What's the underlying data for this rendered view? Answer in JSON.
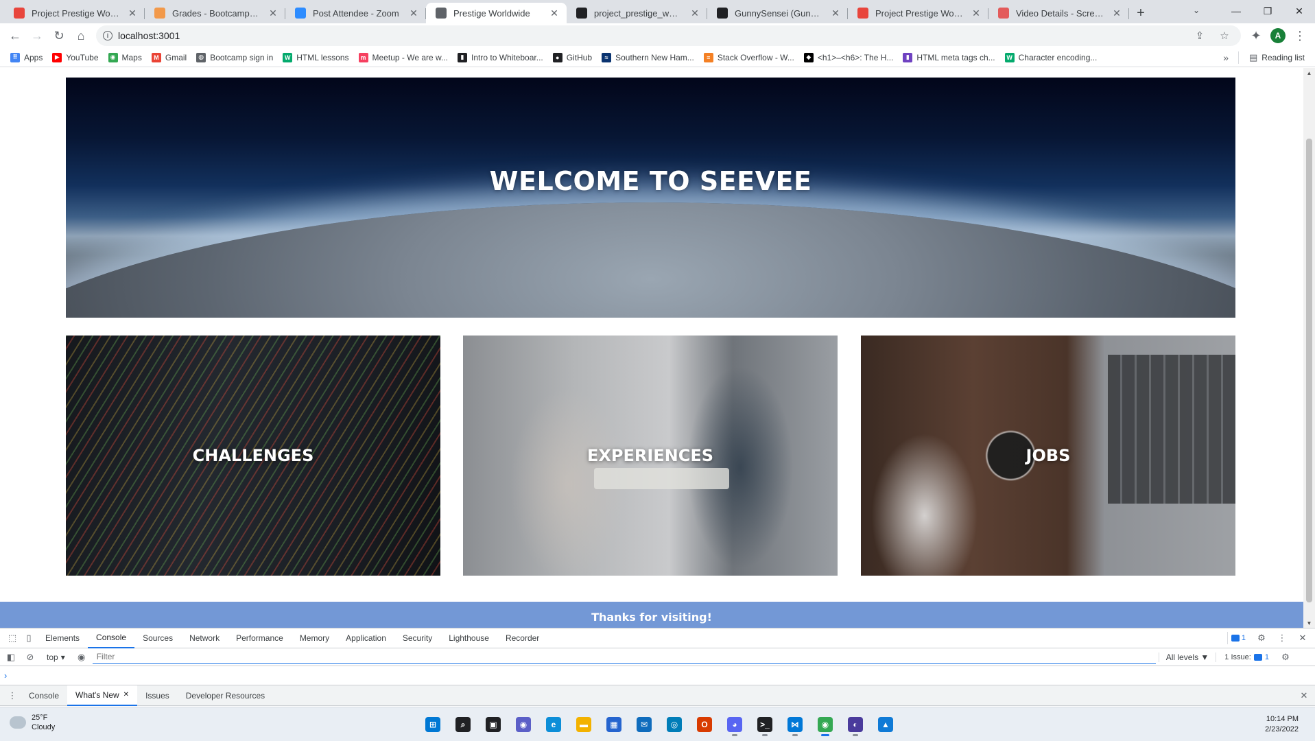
{
  "browser": {
    "tabs": [
      {
        "title": "Project Prestige Worldwide",
        "icon": "figma-icon",
        "color": "#e8453c",
        "active": false
      },
      {
        "title": "Grades - Bootcamp: UTA-V",
        "icon": "bootcamp-icon",
        "color": "#f2994a",
        "active": false
      },
      {
        "title": "Post Attendee - Zoom",
        "icon": "zoom-icon",
        "color": "#2d8cff",
        "active": false
      },
      {
        "title": "Prestige Worldwide",
        "icon": "globe-icon",
        "color": "#5f6368",
        "active": true
      },
      {
        "title": "project_prestige_worldwide",
        "icon": "github-icon",
        "color": "#202124",
        "active": false
      },
      {
        "title": "GunnySensei (Gunner Wag",
        "icon": "github-icon",
        "color": "#202124",
        "active": false
      },
      {
        "title": "Project Prestige Worldwide",
        "icon": "figma-icon",
        "color": "#e8453c",
        "active": false
      },
      {
        "title": "Video Details - Screencast",
        "icon": "screencast-icon",
        "color": "#e35b5b",
        "active": false
      }
    ],
    "new_tab_glyph": "+",
    "close_glyph": "✕",
    "window_controls": {
      "minimize": "—",
      "maximize": "❐",
      "close": "✕"
    },
    "tab_search_glyph": "⌄",
    "address": "localhost:3001",
    "info_glyph": "i",
    "nav": {
      "back": "←",
      "forward": "→",
      "reload": "↻",
      "home": "⌂"
    },
    "omnibox_icons": {
      "share": "⇪",
      "star": "☆"
    },
    "extensions_glyph": "✦",
    "profile_initial": "A",
    "menu_glyph": "⋮",
    "bookmarks": [
      {
        "label": "Apps",
        "icon": "apps-grid-icon",
        "color": "#4285f4",
        "glyph": "⠿"
      },
      {
        "label": "YouTube",
        "icon": "youtube-icon",
        "color": "#ff0000",
        "glyph": "▶"
      },
      {
        "label": "Maps",
        "icon": "maps-icon",
        "color": "#34a853",
        "glyph": "◉"
      },
      {
        "label": "Gmail",
        "icon": "gmail-icon",
        "color": "#ea4335",
        "glyph": "M"
      },
      {
        "label": "Bootcamp sign in",
        "icon": "globe-icon",
        "color": "#5f6368",
        "glyph": "◍"
      },
      {
        "label": "HTML lessons",
        "icon": "w3-icon",
        "color": "#04aa6d",
        "glyph": "W"
      },
      {
        "label": "Meetup - We are w...",
        "icon": "meetup-icon",
        "color": "#f64060",
        "glyph": "m"
      },
      {
        "label": "Intro to Whiteboar...",
        "icon": "doc-icon",
        "color": "#202124",
        "glyph": "▮"
      },
      {
        "label": "GitHub",
        "icon": "github-icon",
        "color": "#202124",
        "glyph": "●"
      },
      {
        "label": "Southern New Ham...",
        "icon": "snhu-icon",
        "color": "#0a3370",
        "glyph": "≈"
      },
      {
        "label": "Stack Overflow - W...",
        "icon": "stackoverflow-icon",
        "color": "#f48024",
        "glyph": "≡"
      },
      {
        "label": "<h1>–<h6>: The H...",
        "icon": "mdn-icon",
        "color": "#000000",
        "glyph": "◆"
      },
      {
        "label": "HTML meta tags ch...",
        "icon": "bookmark-purple-icon",
        "color": "#6f42c1",
        "glyph": "▮"
      },
      {
        "label": "Character encoding...",
        "icon": "w3-icon",
        "color": "#04aa6d",
        "glyph": "W"
      }
    ],
    "bookmarks_overflow": "»",
    "reading_list": "Reading list"
  },
  "page": {
    "hero_title": "WELCOME TO SEEVEE",
    "cards": [
      {
        "label": "CHALLENGES"
      },
      {
        "label": "EXPERIENCES"
      },
      {
        "label": "JOBS"
      }
    ],
    "footer_text": "Thanks for visiting!",
    "footer_color": "#7398d6"
  },
  "devtools": {
    "tabs": [
      "Elements",
      "Console",
      "Sources",
      "Network",
      "Performance",
      "Memory",
      "Application",
      "Security",
      "Lighthouse",
      "Recorder"
    ],
    "active_tab": "Console",
    "message_count": "1",
    "context": "top",
    "filter_placeholder": "Filter",
    "levels": "All levels ▼",
    "issues_label": "1 Issue:",
    "issues_count": "1",
    "prompt": "›",
    "drawer_tabs": [
      "Console",
      "What's New",
      "Issues",
      "Developer Resources"
    ],
    "active_drawer_tab": "What's New"
  },
  "taskbar": {
    "weather_temp": "25°F",
    "weather_desc": "Cloudy",
    "apps": [
      {
        "name": "windows-start-icon",
        "color": "#0078d4",
        "glyph": "⊞"
      },
      {
        "name": "search-icon",
        "color": "#202124",
        "glyph": "⌕"
      },
      {
        "name": "task-view-icon",
        "color": "#202124",
        "glyph": "▣"
      },
      {
        "name": "teams-chat-icon",
        "color": "#5b5fc7",
        "glyph": "◉"
      },
      {
        "name": "edge-icon",
        "color": "#0c8ed8",
        "glyph": "e"
      },
      {
        "name": "file-explorer-icon",
        "color": "#f3b200",
        "glyph": "▬"
      },
      {
        "name": "store-icon",
        "color": "#2564cf",
        "glyph": "▦"
      },
      {
        "name": "mail-icon",
        "color": "#0f6cbd",
        "glyph": "✉"
      },
      {
        "name": "dell-icon",
        "color": "#007db8",
        "glyph": "◎"
      },
      {
        "name": "office-icon",
        "color": "#d83b01",
        "glyph": "O"
      },
      {
        "name": "discord-icon",
        "color": "#5865f2",
        "glyph": "◕"
      },
      {
        "name": "terminal-icon",
        "color": "#202124",
        "glyph": ">_"
      },
      {
        "name": "vscode-icon",
        "color": "#0078d7",
        "glyph": "⋈"
      },
      {
        "name": "chrome-icon",
        "color": "#34a853",
        "glyph": "◉"
      },
      {
        "name": "eclipse-icon",
        "color": "#4a3b9c",
        "glyph": "◐"
      },
      {
        "name": "photos-icon",
        "color": "#0f7ad6",
        "glyph": "▲"
      }
    ],
    "time": "10:14 PM",
    "date": "2/23/2022"
  }
}
